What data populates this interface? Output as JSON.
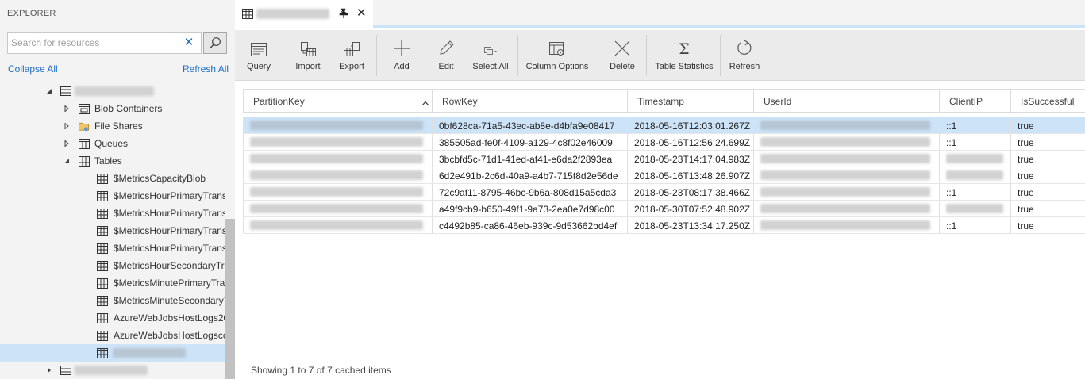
{
  "explorer": {
    "title": "EXPLORER",
    "search_placeholder": "Search for resources",
    "collapse_all": "Collapse All",
    "refresh_all": "Refresh All",
    "tree": [
      {
        "label": "",
        "icon": "storage-account-icon",
        "expanded": true,
        "redacted": true
      },
      {
        "label": "Blob Containers",
        "icon": "blob-containers-icon",
        "expanded": false
      },
      {
        "label": "File Shares",
        "icon": "file-shares-icon",
        "expanded": false
      },
      {
        "label": "Queues",
        "icon": "queues-icon",
        "expanded": false
      },
      {
        "label": "Tables",
        "icon": "tables-icon",
        "expanded": true
      },
      {
        "label": "$MetricsCapacityBlob",
        "icon": "table-icon"
      },
      {
        "label": "$MetricsHourPrimaryTrans",
        "icon": "table-icon"
      },
      {
        "label": "$MetricsHourPrimaryTrans",
        "icon": "table-icon"
      },
      {
        "label": "$MetricsHourPrimaryTrans",
        "icon": "table-icon"
      },
      {
        "label": "$MetricsHourPrimaryTrans",
        "icon": "table-icon"
      },
      {
        "label": "$MetricsHourSecondaryTra",
        "icon": "table-icon"
      },
      {
        "label": "$MetricsMinutePrimaryTrar",
        "icon": "table-icon"
      },
      {
        "label": "$MetricsMinuteSecondaryT",
        "icon": "table-icon"
      },
      {
        "label": "AzureWebJobsHostLogs20",
        "icon": "table-icon"
      },
      {
        "label": "AzureWebJobsHostLogsco",
        "icon": "table-icon"
      },
      {
        "label": "",
        "icon": "table-icon",
        "selected": true,
        "redacted": true
      },
      {
        "label": "",
        "icon": "storage-account-icon",
        "expanded": false,
        "redacted": true
      }
    ]
  },
  "tab": {
    "title": "",
    "redacted": true
  },
  "toolbar": {
    "buttons": [
      {
        "label": "Query",
        "icon": "query-icon"
      },
      {
        "label": "Import",
        "icon": "import-icon"
      },
      {
        "label": "Export",
        "icon": "export-icon"
      },
      {
        "label": "Add",
        "icon": "add-icon"
      },
      {
        "label": "Edit",
        "icon": "edit-icon"
      },
      {
        "label": "Select All",
        "icon": "select-all-icon"
      },
      {
        "label": "Column Options",
        "icon": "column-options-icon"
      },
      {
        "label": "Delete",
        "icon": "delete-icon"
      },
      {
        "label": "Table Statistics",
        "icon": "table-statistics-icon"
      },
      {
        "label": "Refresh",
        "icon": "refresh-icon"
      }
    ]
  },
  "grid": {
    "columns": [
      "PartitionKey",
      "RowKey",
      "Timestamp",
      "UserId",
      "ClientIP",
      "IsSuccessful"
    ],
    "rows": [
      {
        "RowKey": "0bf628ca-71a5-43ec-ab8e-d4bfa9e08417",
        "Timestamp": "2018-05-16T12:03:01.267Z",
        "ClientIP": "::1",
        "IsSuccessful": "true",
        "selected": true
      },
      {
        "RowKey": "385505ad-fe0f-4109-a129-4c8f02e46009",
        "Timestamp": "2018-05-16T12:56:24.699Z",
        "ClientIP": "::1",
        "IsSuccessful": "true"
      },
      {
        "RowKey": "3bcbfd5c-71d1-41ed-af41-e6da2f2893ea",
        "Timestamp": "2018-05-23T14:17:04.983Z",
        "ClientIP": "",
        "IsSuccessful": "true"
      },
      {
        "RowKey": "6d2e491b-2c6d-40a9-a4b7-715f8d2e56de",
        "Timestamp": "2018-05-16T13:48:26.907Z",
        "ClientIP": "",
        "IsSuccessful": "true"
      },
      {
        "RowKey": "72c9af11-8795-46bc-9b6a-808d15a5cda3",
        "Timestamp": "2018-05-23T08:17:38.466Z",
        "ClientIP": "::1",
        "IsSuccessful": "true"
      },
      {
        "RowKey": "a49f9cb9-b650-49f1-9a73-2ea0e7d98c00",
        "Timestamp": "2018-05-30T07:52:48.902Z",
        "ClientIP": "",
        "IsSuccessful": "true"
      },
      {
        "RowKey": "c4492b85-ca86-46eb-939c-9d53662bd4ef",
        "Timestamp": "2018-05-23T13:34:17.250Z",
        "ClientIP": "::1",
        "IsSuccessful": "true"
      }
    ]
  },
  "status": {
    "text": "Showing 1 to 7 of 7 cached items"
  },
  "colors": {
    "accent": "#1e6fc4",
    "selection": "#cde3f7",
    "panel": "#f3f3f3",
    "toolbar": "#ebebeb"
  }
}
